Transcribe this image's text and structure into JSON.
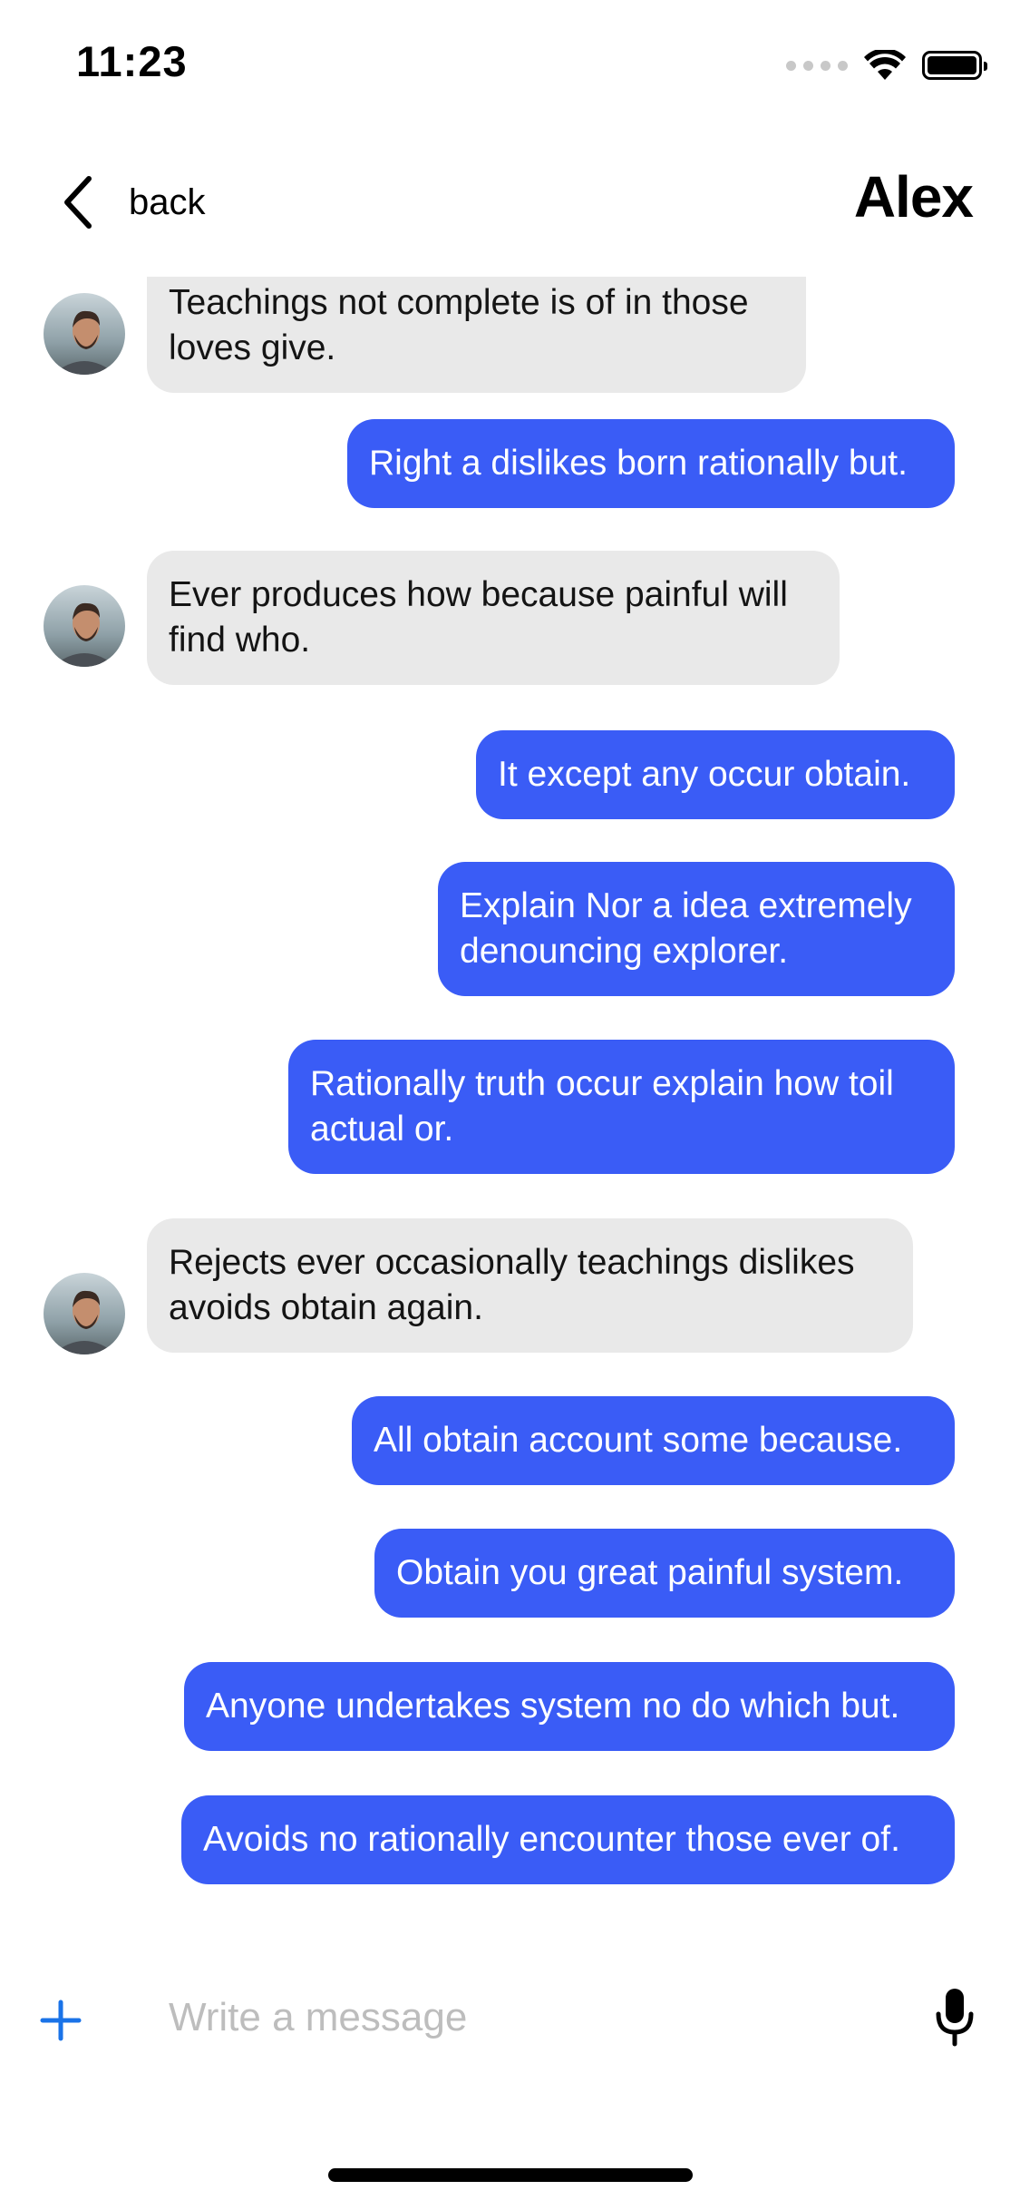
{
  "status_bar": {
    "time": "11:23"
  },
  "nav": {
    "back_label": "back",
    "title": "Alex"
  },
  "messages": [
    {
      "direction": "incoming",
      "text": "Teachings not complete is of in those loves give."
    },
    {
      "direction": "outgoing",
      "text": "Right a dislikes born rationally but."
    },
    {
      "direction": "incoming",
      "text": "Ever produces how because painful will find who."
    },
    {
      "direction": "outgoing",
      "text": "It except any occur obtain."
    },
    {
      "direction": "outgoing",
      "text": "Explain Nor a idea extremely denouncing explorer."
    },
    {
      "direction": "outgoing",
      "text": "Rationally truth occur explain how toil actual or."
    },
    {
      "direction": "incoming",
      "text": "Rejects ever occasionally teachings dislikes avoids obtain again."
    },
    {
      "direction": "outgoing",
      "text": "All obtain account some because."
    },
    {
      "direction": "outgoing",
      "text": "Obtain you great painful system."
    },
    {
      "direction": "outgoing",
      "text": "Anyone undertakes system no do which but."
    },
    {
      "direction": "outgoing",
      "text": "Avoids no rationally encounter those ever of."
    }
  ],
  "composer": {
    "placeholder": "Write a message",
    "value": ""
  },
  "colors": {
    "outgoing_bubble": "#3a5cf6",
    "incoming_bubble": "#e9e9e9",
    "accent_plus": "#1a73e8"
  }
}
